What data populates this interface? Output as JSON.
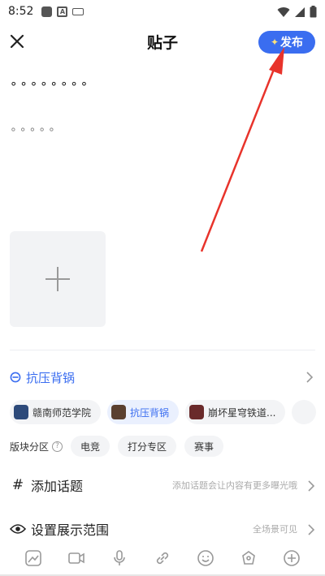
{
  "status_bar": {
    "time": "8:52"
  },
  "header": {
    "title": "贴子",
    "publish_label": "发布"
  },
  "post": {
    "title_text": "∘∘∘∘∘∘∘∘",
    "body_text": "∘∘∘∘∘"
  },
  "forum": {
    "selected": "抗压背锅"
  },
  "forum_chips": [
    {
      "label": "赣南师范学院",
      "avatar_color": "#2d4a7a"
    },
    {
      "label": "抗压背锅",
      "avatar_color": "#5a4030"
    },
    {
      "label": "崩坏星穹铁道...",
      "avatar_color": "#6a2a2a"
    }
  ],
  "section": {
    "label": "版块分区",
    "tags": [
      "电竞",
      "打分专区",
      "赛事"
    ]
  },
  "topic": {
    "label": "添加话题",
    "hint": "添加话题会让内容有更多曝光哦"
  },
  "scope": {
    "label": "设置展示范围",
    "hint": "全场景可见"
  },
  "colors": {
    "accent": "#3a6df0",
    "annotation_arrow": "#e8332b"
  },
  "toolbar_icons": [
    "image-icon",
    "video-icon",
    "microphone-icon",
    "link-icon",
    "emoji-icon",
    "game-icon",
    "add-circle-icon"
  ]
}
